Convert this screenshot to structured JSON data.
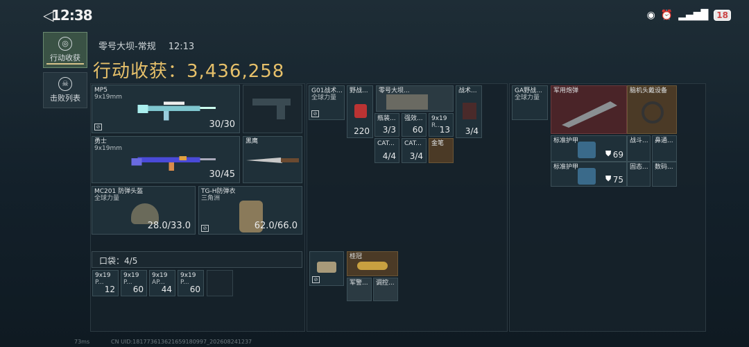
{
  "status": {
    "time": "12:38",
    "battery": "18"
  },
  "sidebar": {
    "tab_haul": "行动收获",
    "tab_kills": "击败列表"
  },
  "header": {
    "map": "零号大坝-常规",
    "duration": "12:13",
    "haul_label": "行动收获：",
    "haul_value": "3,436,258"
  },
  "gear": [
    {
      "name": "MP5",
      "sub": "9x19mm",
      "value": "30/30"
    },
    {
      "name": "勇士",
      "sub": "9x19mm",
      "value": "30/45"
    },
    {
      "name": "黑鹰",
      "sub": "",
      "value": ""
    },
    {
      "name": "MC201 防弹头盔",
      "sub": "全球力量",
      "value": "28.0/33.0"
    },
    {
      "name": "TG-H防弹衣",
      "sub": "三角洲",
      "value": "62.0/66.0"
    }
  ],
  "pocket": {
    "label": "口袋：",
    "count": "4/5",
    "items": [
      {
        "name": "9x19",
        "sub": "P...",
        "count": "12"
      },
      {
        "name": "9x19",
        "sub": "P...",
        "count": "60"
      },
      {
        "name": "9x19",
        "sub": "AP...",
        "count": "44"
      },
      {
        "name": "9x19",
        "sub": "P...",
        "count": "60"
      }
    ]
  },
  "mid": [
    {
      "name": "G01战术...",
      "sub": "全球力量"
    },
    {
      "name": "野战...",
      "count": "220"
    },
    {
      "name": "零号大坝...",
      "count": ""
    },
    {
      "name": "战术...",
      "count": "3/4"
    },
    {
      "name": "瓶装...",
      "count": "3/3"
    },
    {
      "name": "强效...",
      "count": "60"
    },
    {
      "name": "9x19",
      "sub": "R...",
      "count": "13"
    },
    {
      "name": "CAT...",
      "count": "4/4"
    },
    {
      "name": "CAT...",
      "count": "3/4"
    },
    {
      "name": "金笔",
      "count": ""
    },
    {
      "name": "桂冠",
      "count": ""
    },
    {
      "name": "军警...",
      "count": ""
    },
    {
      "name": "调控...",
      "count": ""
    }
  ],
  "right": [
    {
      "name": "GA野战...",
      "sub": "全球力量"
    },
    {
      "name": "军用炮弹"
    },
    {
      "name": "脑机头戴设备"
    },
    {
      "name": "标准护甲",
      "count": "69"
    },
    {
      "name": "战斗..."
    },
    {
      "name": "鼻通..."
    },
    {
      "name": "标准护甲",
      "count": "75"
    },
    {
      "name": "固态..."
    },
    {
      "name": "数码..."
    }
  ],
  "footer": {
    "ping": "73ms",
    "uid": "CN UID:181773613621659180997_202608241237"
  }
}
